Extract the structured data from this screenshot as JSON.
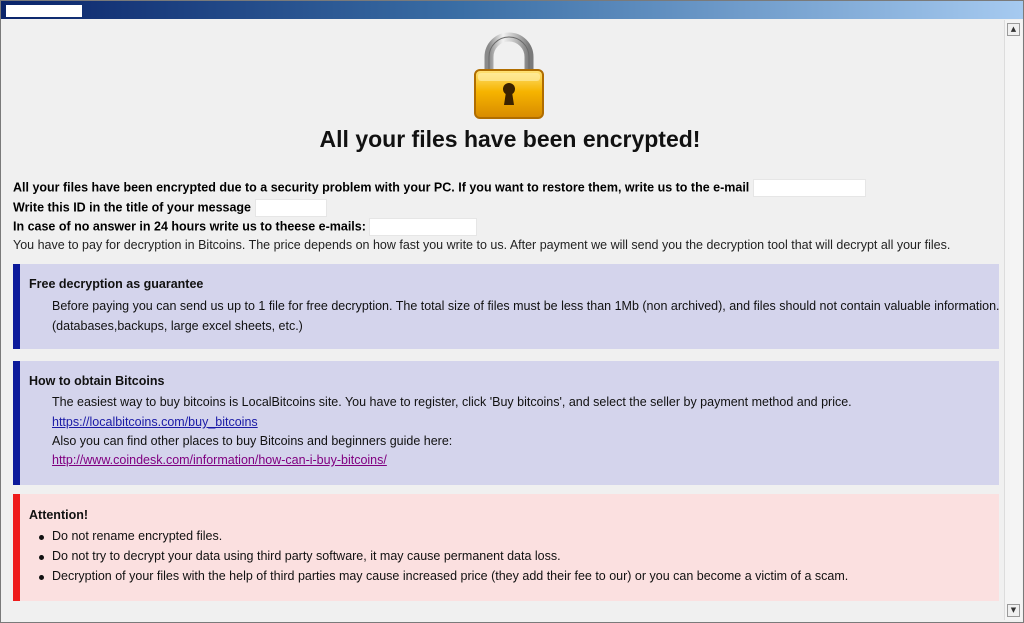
{
  "window": {
    "title": ""
  },
  "headline": "All your files have been encrypted!",
  "intro": {
    "line1": "All your files have been encrypted due to a security problem with your PC. If you want to restore them, write us to the e-mail",
    "line2": "Write this ID in the title of your message",
    "line3": "In case of no answer in 24 hours write us to theese e-mails:",
    "line4": "You have to pay for decryption in Bitcoins. The price depends on how fast you write to us. After payment we will send you the decryption tool that will decrypt all your files."
  },
  "guarantee": {
    "heading": "Free decryption as guarantee",
    "text1": "Before paying you can send us up to 1 file for free decryption. The total size of files must be less than 1Mb (non archived), and files should not contain valuable information.",
    "text2": "(databases,backups, large excel sheets, etc.)"
  },
  "bitcoins": {
    "heading": "How to obtain Bitcoins",
    "text1": "The easiest way to buy bitcoins is LocalBitcoins site. You have to register, click 'Buy bitcoins', and select the seller by payment method and price.",
    "link1": "https://localbitcoins.com/buy_bitcoins",
    "text2": "Also you can find other places to buy Bitcoins and beginners guide here:",
    "link2": "http://www.coindesk.com/information/how-can-i-buy-bitcoins/"
  },
  "attention": {
    "heading": "Attention!",
    "items": [
      "Do not rename encrypted files.",
      "Do not try to decrypt your data using third party software, it may cause permanent data loss.",
      "Decryption of your files with the help of third parties may cause increased price (they add their fee to our) or you can become a victim of a scam."
    ]
  },
  "colors": {
    "info_bar": "#0c1a9b",
    "info_bg": "#d4d4ec",
    "warn_bar": "#ee1c1c",
    "warn_bg": "#fbe0e0"
  },
  "icons": {
    "lock": "padlock-icon",
    "scroll_up": "scroll-up-arrow-icon",
    "scroll_down": "scroll-down-arrow-icon"
  }
}
